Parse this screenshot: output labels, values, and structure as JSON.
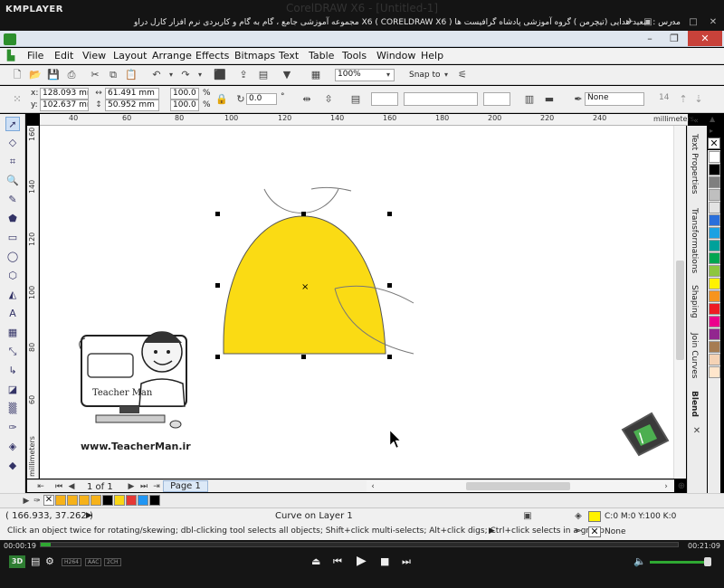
{
  "player": {
    "logo": "KMPLAYER",
    "title": "مجموعه آموزشی جامع ، گام به گام و کاربردی نرم افزار کارل دراو X6 ( CORELDRAW X6 )   مدرس : سعید هدایی (تیچرمن ) گروه آموزشی پادشاه گرافیست ها",
    "time_elapsed": "00:00:19",
    "time_total": "00:21:09",
    "progress_fraction": 0.015,
    "badges": [
      "H264",
      "AAC",
      "2CH"
    ],
    "mode": "3D"
  },
  "window": {
    "title": "CorelDRAW X6 - [Untitled-1]",
    "close_symbol": "✕",
    "min_symbol": "–",
    "restore_symbol": "❐"
  },
  "menu": [
    "File",
    "Edit",
    "View",
    "Layout",
    "Arrange",
    "Effects",
    "Bitmaps",
    "Text",
    "Table",
    "Tools",
    "Window",
    "Help"
  ],
  "toolbar": {
    "zoom": "100%",
    "snap_to": "Snap to"
  },
  "property_bar": {
    "x_label": "x:",
    "y_label": "y:",
    "x": "128.093 mm",
    "y": "102.637 mm",
    "width": "61.491 mm",
    "height": "50.952 mm",
    "scale_x": "100.0",
    "scale_y": "100.0",
    "percent": "%",
    "rotation": "0.0",
    "degree": "°",
    "outline": "None",
    "outline_size": "14"
  },
  "ruler": {
    "units": "millimeters",
    "top_ticks": [
      "40",
      "60",
      "80",
      "100",
      "120",
      "140",
      "160",
      "180",
      "200",
      "220",
      "240"
    ],
    "left_ticks": [
      "160",
      "140",
      "120",
      "100",
      "80",
      "60"
    ]
  },
  "dockers": [
    "Text Properties",
    "Transformations",
    "Shaping",
    "Join Curves",
    "Blend"
  ],
  "palette_colors": [
    "#ffffff",
    "#000000",
    "#7f7f7f",
    "#bfbfbf",
    "#e3e3e3",
    "#2a6fdb",
    "#1ba1e2",
    "#00a19a",
    "#00a651",
    "#8dc63f",
    "#fff200",
    "#f7941d",
    "#ed1c24",
    "#ec008c",
    "#92278f",
    "#a67c52",
    "#f5d3b5",
    "#ffe6cc"
  ],
  "page_nav": {
    "page_count": "1 of 1",
    "page_tab": "Page 1"
  },
  "doc_palette": [
    "#f6b21a",
    "#f6b21a",
    "#f6b21a",
    "#f6b21a",
    "#000000",
    "#f9d616",
    "#e53935",
    "#2196f3",
    "#000000"
  ],
  "status": {
    "coords": "( 166.933, 37.262 )",
    "object_info": "Curve on Layer 1",
    "hint": "Click an object twice for rotating/skewing; dbl-clicking tool selects all objects; Shift+click multi-selects; Alt+click digs; Ctrl+click selects in a group",
    "fill_color": "#fff200",
    "fill_text": "C:0 M:0 Y:100 K:0",
    "outline_text": "None"
  },
  "shape": {
    "fill": "#fadb14",
    "stroke": "#555555"
  },
  "logo": {
    "url_text": "www.TeacherMan.ir",
    "name_text": "Teacher Man"
  }
}
